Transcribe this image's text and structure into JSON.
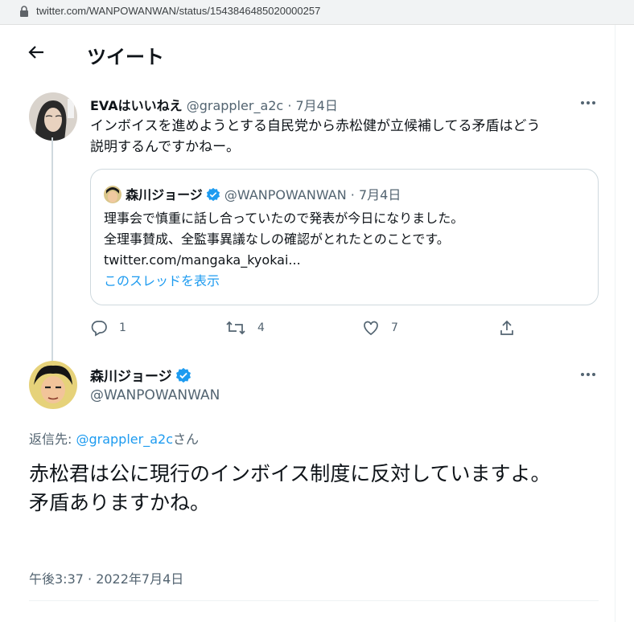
{
  "browser": {
    "url": "twitter.com/WANPOWANWAN/status/1543846485020000257"
  },
  "header": {
    "title": "ツイート"
  },
  "parent_tweet": {
    "display_name": "EVAはいいねえ",
    "handle": "@grappler_a2c",
    "date": "7月4日",
    "text_line1": "インボイスを進めようとする自民党から赤松健が立候補してる矛盾はどう",
    "text_line2": "説明するんですかねー。",
    "quote": {
      "display_name": "森川ジョージ",
      "handle": "@WANPOWANWAN",
      "date": "7月4日",
      "line1": "理事会で慎重に話し合っていたので発表が今日になりました。",
      "line2": "全理事賛成、全監事異議なしの確認がとれたとのことです。",
      "line3": "twitter.com/mangaka_kyokai...",
      "show_thread": "このスレッドを表示"
    },
    "actions": {
      "replies": "1",
      "retweets": "4",
      "likes": "7"
    }
  },
  "main_tweet": {
    "display_name": "森川ジョージ",
    "handle": "@WANPOWANWAN",
    "reply_to_label": "返信先: ",
    "reply_to_handle": "@grappler_a2c",
    "reply_to_suffix": "さん",
    "text_line1": "赤松君は公に現行のインボイス制度に反対していますよ。",
    "text_line2": "矛盾ありますかね。",
    "timestamp": "午後3:37 · 2022年7月4日"
  },
  "colors": {
    "accent": "#1d9bf0",
    "secondary_text": "#536471",
    "border": "#cfd9de"
  }
}
